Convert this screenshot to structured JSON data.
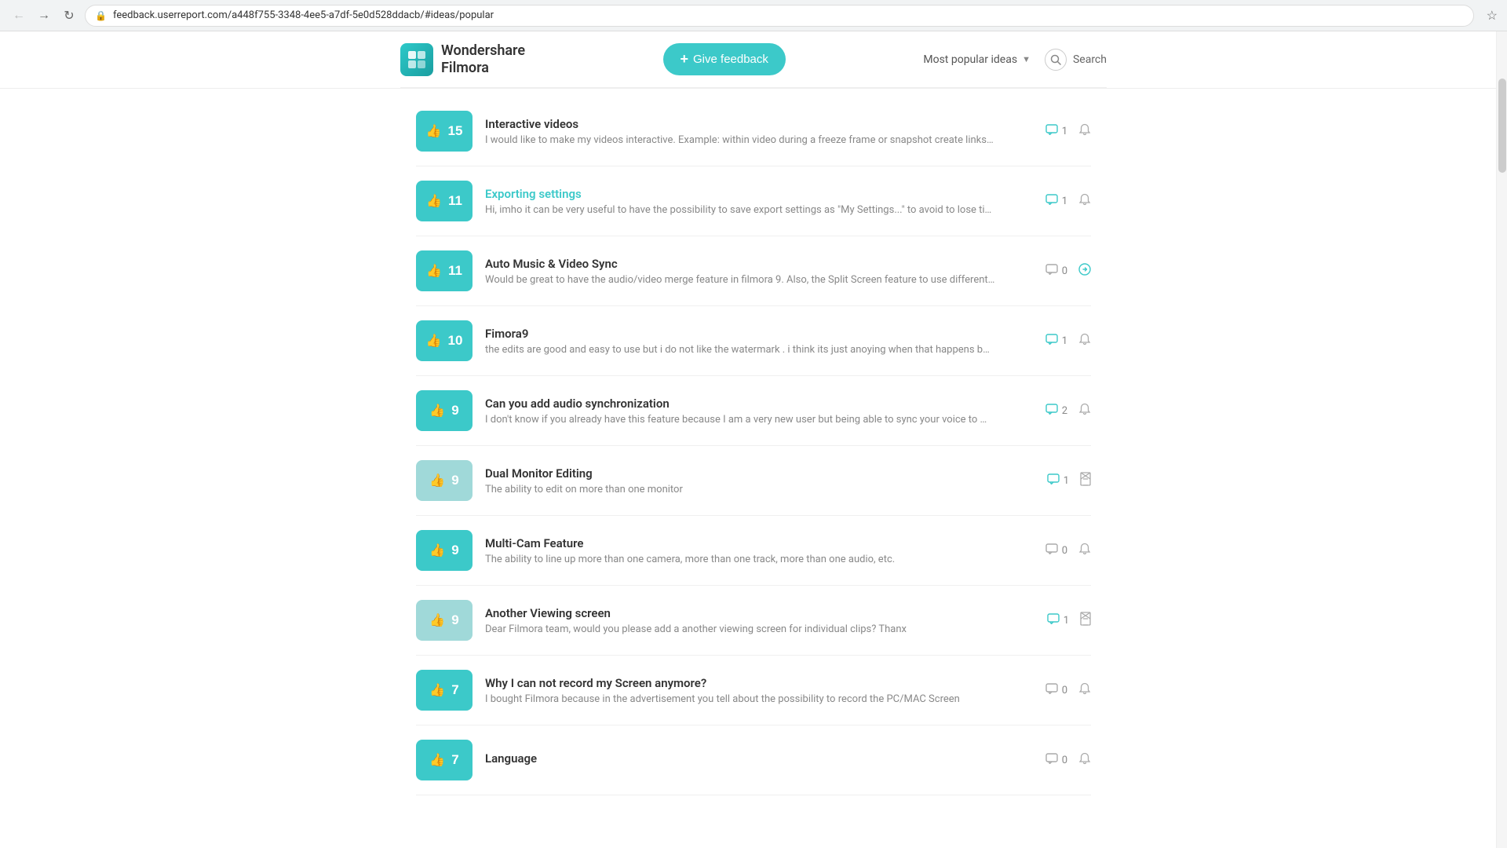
{
  "browser": {
    "url": "feedback.userreport.com/a448f755-3348-4ee5-a7df-5e0d528ddacb/#ideas/popular"
  },
  "header": {
    "logo_text_line1": "Wondershare",
    "logo_text_line2": "Filmora",
    "give_feedback_label": "Give feedback",
    "most_popular_label": "Most popular ideas",
    "search_label": "Search"
  },
  "ideas": [
    {
      "votes": 15,
      "vote_active": true,
      "title": "Interactive videos",
      "title_link": false,
      "description": "I would like to make my videos interactive. Example: within video during a freeze frame or snapshot create links…",
      "comments": 1,
      "notifications": true,
      "status_icon": "bell"
    },
    {
      "votes": 11,
      "vote_active": true,
      "title": "Exporting settings",
      "title_link": true,
      "description": "Hi, imho it can be very useful to have the possibility to save export settings as \"My Settings...\" to avoid to lose ti…",
      "comments": 1,
      "notifications": true,
      "status_icon": "bell"
    },
    {
      "votes": 11,
      "vote_active": true,
      "title": "Auto Music & Video Sync",
      "title_link": false,
      "description": "Would be great to have the audio/video merge feature in filmora 9. Also, the Split Screen feature to use different…",
      "comments": 0,
      "notifications": false,
      "status_icon": "arrow"
    },
    {
      "votes": 10,
      "vote_active": true,
      "title": "Fimora9",
      "title_link": false,
      "description": "the edits are good and easy to use but i do not like the watermark . i think its just anoying when that happens b…",
      "comments": 1,
      "notifications": true,
      "status_icon": "bell"
    },
    {
      "votes": 9,
      "vote_active": true,
      "title": "Can you add audio synchronization",
      "title_link": false,
      "description": "I don't know if you already have this feature because I am a very new user but being able to sync your voice to …",
      "comments": 2,
      "notifications": true,
      "status_icon": "bell"
    },
    {
      "votes": 9,
      "vote_active": false,
      "title": "Dual Monitor Editing",
      "title_link": false,
      "description": "The ability to edit on more than one monitor",
      "comments": 1,
      "notifications": false,
      "status_icon": "hourglass"
    },
    {
      "votes": 9,
      "vote_active": true,
      "title": "Multi-Cam Feature",
      "title_link": false,
      "description": "The ability to line up more than one camera, more than one track, more than one audio, etc.",
      "comments": 0,
      "notifications": true,
      "status_icon": "bell"
    },
    {
      "votes": 9,
      "vote_active": false,
      "title": "Another Viewing screen",
      "title_link": false,
      "description": "Dear Filmora team, would you please add a another viewing screen for individual clips? Thanx",
      "comments": 1,
      "notifications": false,
      "status_icon": "hourglass"
    },
    {
      "votes": 7,
      "vote_active": true,
      "title": "Why I can not record my Screen anymore?",
      "title_link": false,
      "description": "I bought Filmora because in the advertisement you tell about the possibility to record the PC/MAC Screen",
      "comments": 0,
      "notifications": true,
      "status_icon": "bell"
    },
    {
      "votes": 7,
      "vote_active": true,
      "title": "Language",
      "title_link": false,
      "description": "",
      "comments": 0,
      "notifications": false,
      "status_icon": "bell"
    }
  ]
}
